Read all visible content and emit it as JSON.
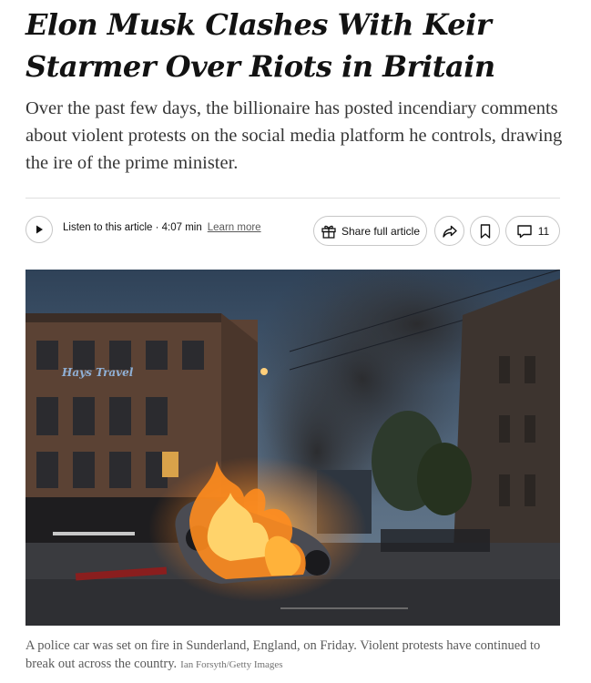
{
  "article": {
    "headline": "Elon Musk Clashes With Keir Starmer Over Riots in Britain",
    "summary": "Over the past few days, the billionaire has posted incendiary comments about violent protests on the social media platform he controls, drawing the ire of the prime minister."
  },
  "toolbar": {
    "listen_label": "Listen to this article · 4:07 min",
    "learn_more": "Learn more",
    "share_full_label": "Share full article",
    "comment_count": "11"
  },
  "photo": {
    "sign_text": "Hays Travel",
    "caption": "A police car was set on fire in Sunderland, England, on Friday. Violent protests have continued to break out across the country.",
    "credit": "Ian Forsyth/Getty Images"
  },
  "colors": {
    "text": "#121212",
    "muted": "#5a5a5a",
    "border": "#c7c7c7"
  },
  "icons": [
    "play-icon",
    "gift-icon",
    "share-arrow-icon",
    "bookmark-icon",
    "comment-icon"
  ]
}
